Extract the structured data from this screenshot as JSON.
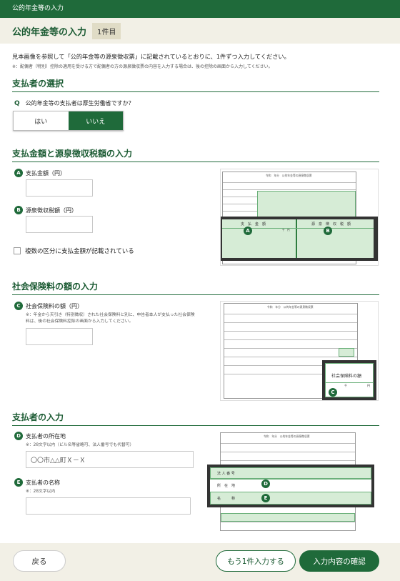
{
  "header": {
    "breadcrumb": "公的年金等の入力",
    "title": "公的年金等の入力",
    "count_badge": "1件目"
  },
  "intro": {
    "text": "見本画像を参照して「公的年金等の源泉徴収票」に記載されているとおりに、1件ずつ入力してください。",
    "note": "※：配偶者（特別）控除の適用を受ける方で配偶者の方の源泉徴収票の内容を入力する場合は、後の控除の画面から入力してください。"
  },
  "payer_select": {
    "heading": "支払者の選択",
    "q_mark": "Q",
    "question": "公的年金等の支払者は厚生労働省ですか？",
    "yes": "はい",
    "no": "いいえ",
    "selected": "いいえ"
  },
  "amounts": {
    "heading": "支払金額と源泉徴収税額の入力",
    "payment_marker": "A",
    "payment_label": "支払金額（円）",
    "payment_value": "",
    "withholding_marker": "B",
    "withholding_label": "源泉徴収税額（円）",
    "withholding_value": "",
    "multiple_label": "複数の区分に支払金額が記載されている",
    "multiple_checked": false,
    "sample": {
      "doc_title": "令和　年分　公的年金等の源泉徴収票",
      "col_a": "支　払　金　額",
      "col_b": "源　泉　徴　収　税　額",
      "unit": "千　円",
      "marker_a": "A",
      "marker_b": "B"
    }
  },
  "social_insurance": {
    "heading": "社会保険料の額の入力",
    "marker": "C",
    "label": "社会保険料の額（円）",
    "note": "※：年金から天引き（特別徴収）された社会保険料と別に、申告者本人が支払った社会保険料は、後の社会保険料控除の画面から入力してください。",
    "value": "",
    "sample": {
      "doc_title": "令和　年分　公的年金等の源泉徴収票",
      "callout": "社会保険料の額",
      "unit_thousand": "千",
      "unit_yen": "円",
      "marker": "C"
    }
  },
  "payer_info": {
    "heading": "支払者の入力",
    "address_marker": "D",
    "address_label": "支払者の所在地",
    "address_note": "※：28文字以内（ビル名等省略可、法人番号でも代替可）",
    "address_placeholder": "〇〇市△△町Ｘ－Ｘ",
    "name_marker": "E",
    "name_label": "支払者の名称",
    "name_note": "※：28文字以内",
    "name_value": "",
    "sample": {
      "doc_title": "令和　年分　公的年金等の源泉徴収票",
      "row_number": "法 人 番 号",
      "row_address": "所　在　地",
      "row_name": "名　　　称",
      "marker_d": "D",
      "marker_e": "E"
    }
  },
  "footer": {
    "back": "戻る",
    "add_more": "もう1件入力する",
    "confirm": "入力内容の確認"
  },
  "colors": {
    "primary": "#1f6a3a",
    "header_bg": "#1f6a3a",
    "title_bg": "#f2f0e6",
    "badge_bg": "#e0dcc6",
    "sample_highlight": "#d6ecd6"
  }
}
